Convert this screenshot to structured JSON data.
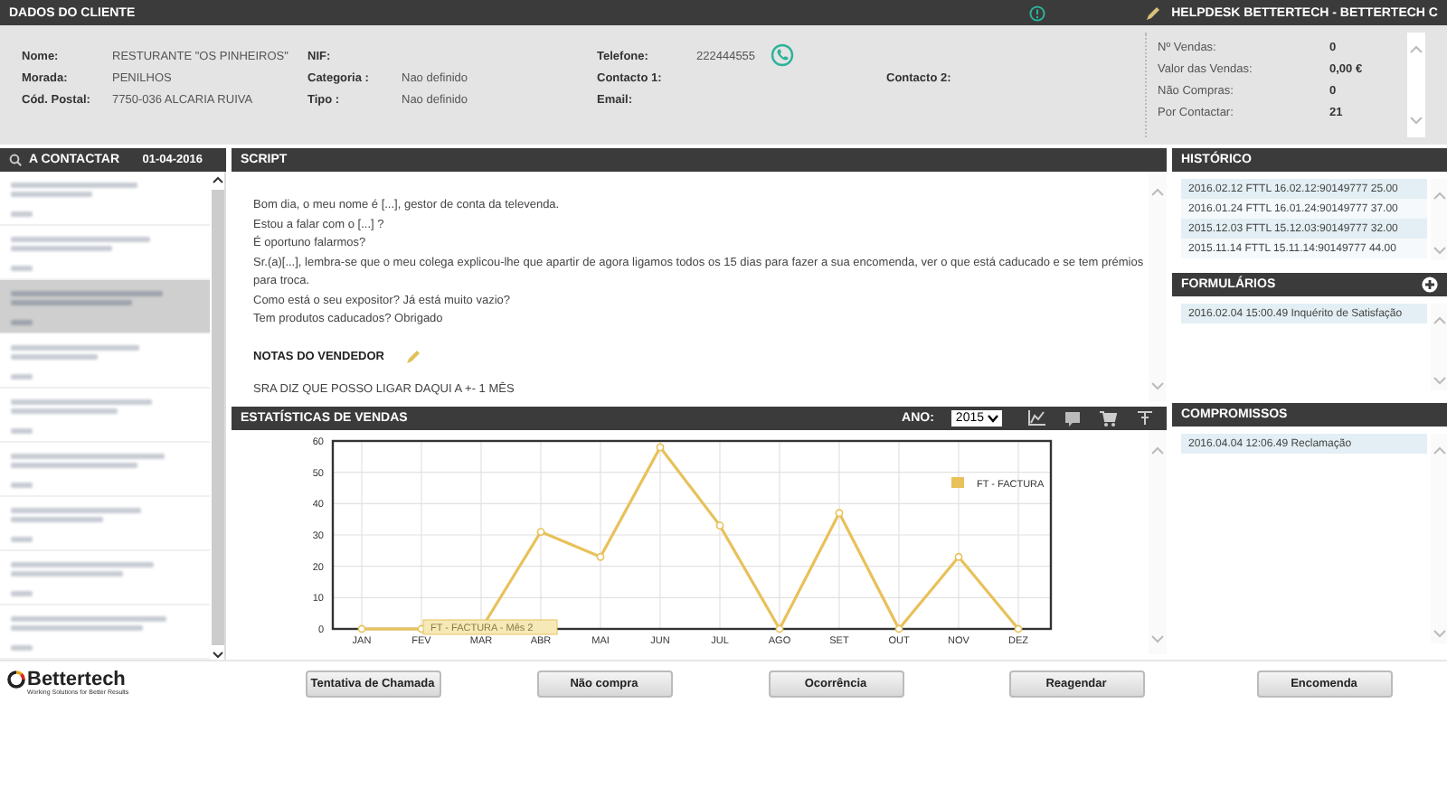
{
  "top_bar": {
    "title": "DADOS DO CLIENTE",
    "user": "HELPDESK BETTERTECH - BETTERTECH C"
  },
  "client": {
    "rows": [
      [
        {
          "label": "Nome:",
          "value": "RESTURANTE \"OS PINHEIROS\""
        },
        {
          "label": "NIF:"
        },
        {
          "label": "Telefone:",
          "value": "222444555",
          "kind": "phone"
        }
      ],
      [
        {
          "label": "Morada:",
          "value": "PENILHOS"
        },
        {
          "label": "Categoria :",
          "value": "Nao definido"
        },
        {
          "label": "Contacto 1:"
        },
        {
          "label": "Contacto 2:"
        }
      ],
      [
        {
          "label": "Cód. Postal:",
          "value": "7750-036 ALCARIA RUIVA"
        },
        {
          "label": "Tipo :",
          "value": "Nao definido"
        },
        {
          "label": "Email:"
        }
      ]
    ]
  },
  "stats": [
    {
      "label": "Nº Vendas:",
      "value": "0"
    },
    {
      "label": "Valor das Vendas:",
      "value": "0,00 €"
    },
    {
      "label": "Não Compras:",
      "value": "0"
    },
    {
      "label": "Por Contactar:",
      "value": "21"
    }
  ],
  "contacts": {
    "title": "A CONTACTAR",
    "date": "01-04-2016",
    "items": [
      {
        "selected": false
      },
      {
        "selected": false
      },
      {
        "selected": true
      },
      {
        "selected": false
      },
      {
        "selected": false
      },
      {
        "selected": false
      },
      {
        "selected": false
      },
      {
        "selected": false
      },
      {
        "selected": false
      }
    ]
  },
  "script": {
    "title": "SCRIPT",
    "lines": [
      "Bom dia, o meu nome é [...], gestor de conta da televenda.",
      "Estou a falar com o [...] ?",
      "É oportuno falarmos?",
      "Sr.(a)[...], lembra-se que o meu colega explicou-lhe que apartir de agora ligamos todos os 15 dias para fazer a sua encomenda, ver o que está caducado e se tem prémios para troca.",
      "Como está o seu expositor? Já está muito vazio?",
      "Tem produtos caducados? Obrigado"
    ],
    "notes_title": "NOTAS DO VENDEDOR",
    "note": "SRA DIZ QUE POSSO LIGAR DAQUI A +- 1 MÊS"
  },
  "sales": {
    "title": "ESTATÍSTICAS DE VENDAS",
    "year_label": "ANO:",
    "year": "2015",
    "tooltip": "FT - FACTURA - Mês 2",
    "chart_data": {
      "type": "line",
      "categories": [
        "JAN",
        "FEV",
        "MAR",
        "ABR",
        "MAI",
        "JUN",
        "JUL",
        "AGO",
        "SET",
        "OUT",
        "NOV",
        "DEZ"
      ],
      "series": [
        {
          "name": "FT - FACTURA",
          "color": "#e8c15a",
          "marker": true,
          "values": [
            0,
            0,
            0,
            31,
            23,
            58,
            33,
            0,
            37,
            0,
            23,
            0
          ]
        }
      ],
      "grid": true,
      "ylim": [
        0,
        60
      ],
      "yticks": [
        0,
        10,
        20,
        30,
        40,
        50,
        60
      ]
    }
  },
  "history": {
    "title": "HISTÓRICO",
    "items": [
      "2016.02.12 FTTL 16.02.12:90149777 25.00",
      "2016.01.24 FTTL 16.01.24:90149777 37.00",
      "2015.12.03 FTTL 15.12.03:90149777 32.00",
      "2015.11.14 FTTL 15.11.14:90149777 44.00"
    ]
  },
  "forms": {
    "title": "FORMULÁRIOS",
    "items": [
      "2016.02.04 15:00.49 Inquérito de Satisfação"
    ]
  },
  "appointments": {
    "title": "COMPROMISSOS",
    "items": [
      "2016.04.04 12:06.49 Reclamação"
    ]
  },
  "footer": {
    "logo": "Bettertech",
    "tagline": "Working Solutions for Better Results",
    "buttons": [
      "Tentativa de Chamada",
      "Não compra",
      "Ocorrência",
      "Reagendar",
      "Encomenda"
    ]
  }
}
